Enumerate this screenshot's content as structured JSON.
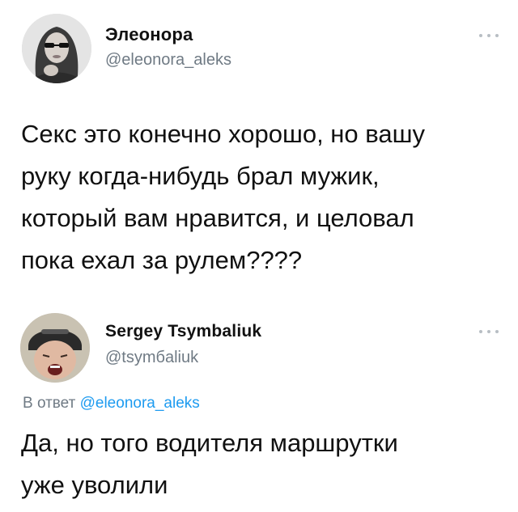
{
  "tweets": [
    {
      "author_name": "Элеонора",
      "author_handle": "@eleonora_aleks",
      "text": "Секс это конечно хорошо, но вашу\nруку когда-нибудь брал мужик,\nкоторый вам нравится, и целовал\nпока ехал за рулем????",
      "more_icon": "more-horizontal-icon"
    },
    {
      "author_name": "Sergey Tsymbaliuk",
      "author_handle": "@tsymбaliuk",
      "reply_prefix": "В ответ",
      "reply_to": "@eleonora_aleks",
      "text": "Да, но того водителя маршрутки\nуже уволили",
      "more_icon": "more-horizontal-icon"
    }
  ],
  "colors": {
    "background": "#ffffff",
    "text": "#111111",
    "secondary": "#6f7a84",
    "mention": "#1d9bf0"
  }
}
